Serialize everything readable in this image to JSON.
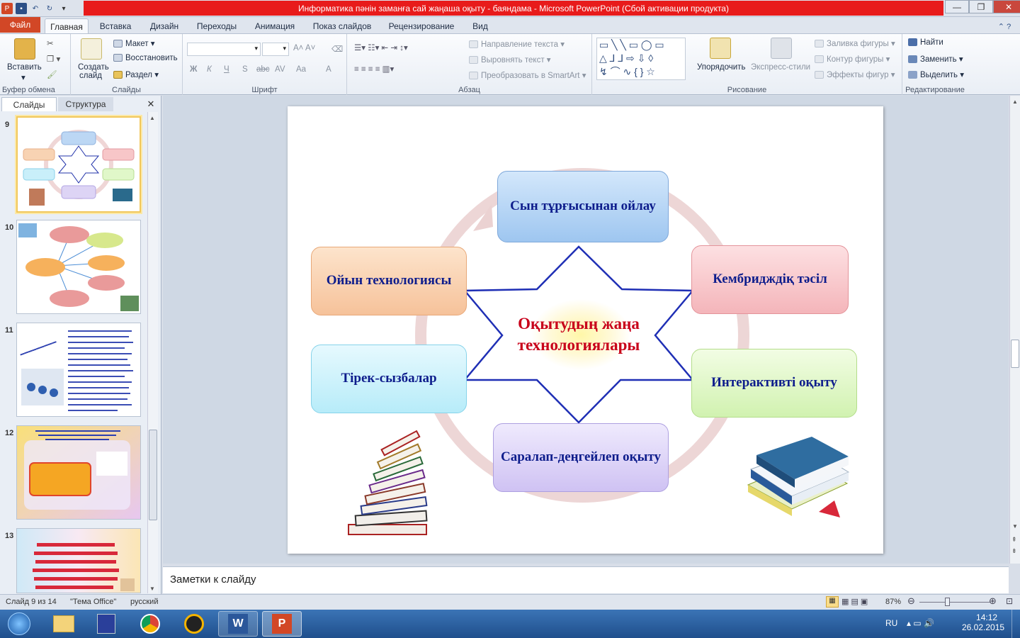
{
  "window": {
    "title": "Информатика пәнін заманға сай жаңаша оқыту - баяндама  -  Microsoft PowerPoint (Сбой активации продукта)"
  },
  "ribbon_tabs": [
    "Файл",
    "Главная",
    "Вставка",
    "Дизайн",
    "Переходы",
    "Анимация",
    "Показ слайдов",
    "Рецензирование",
    "Вид"
  ],
  "ribbon": {
    "clipboard": {
      "paste": "Вставить",
      "label": "Буфер обмена"
    },
    "slides": {
      "new_slide_1": "Создать",
      "new_slide_2": "слайд",
      "layout": "Макет",
      "reset": "Восстановить",
      "section": "Раздел",
      "label": "Слайды"
    },
    "font": {
      "label": "Шрифт",
      "bold": "Ж",
      "italic": "К",
      "underline": "Ч",
      "shadow": "S",
      "strike": "abc",
      "spacing": "AV",
      "case": "Aa",
      "color": "A"
    },
    "paragraph": {
      "text_direction": "Направление текста",
      "align_text": "Выровнять текст",
      "smartart": "Преобразовать в SmartArt",
      "label": "Абзац"
    },
    "drawing": {
      "arrange": "Упорядочить",
      "quick_styles": "Экспресс-стили",
      "fill": "Заливка фигуры",
      "outline": "Контур фигуры",
      "effects": "Эффекты фигур",
      "label": "Рисование"
    },
    "editing": {
      "find": "Найти",
      "replace": "Заменить",
      "select": "Выделить",
      "label": "Редактирование"
    }
  },
  "panel_tabs": {
    "slides": "Слайды",
    "outline": "Структура"
  },
  "thumbnails": [
    {
      "num": "9"
    },
    {
      "num": "10"
    },
    {
      "num": "11"
    },
    {
      "num": "12"
    },
    {
      "num": "13"
    }
  ],
  "slide": {
    "center_text": "Оқытудың жаңа технологиялары",
    "boxes": {
      "top": "Сын тұрғысынан ойлау",
      "left_upper": "Ойын технологиясы",
      "right_upper": "Кембриджді&#1179; тәсіл",
      "left_lower": "Тірек-сызбалар",
      "right_lower": "Интерактивті  оқыту",
      "bottom": "Саралап-деңгейлеп оқыту"
    }
  },
  "notes": {
    "placeholder": "Заметки к слайду"
  },
  "status": {
    "slide_of": "Слайд 9 из 14",
    "theme": "\"Тема Office\"",
    "language": "русский",
    "zoom": "87%"
  },
  "taskbar": {
    "lang": "RU",
    "time": "14:12",
    "date": "26.02.2015"
  },
  "colors": {
    "title_red": "#e81b1b",
    "file_tab": "#d24726",
    "text_blue": "#0e1d8c",
    "center_red": "#c8001a"
  }
}
